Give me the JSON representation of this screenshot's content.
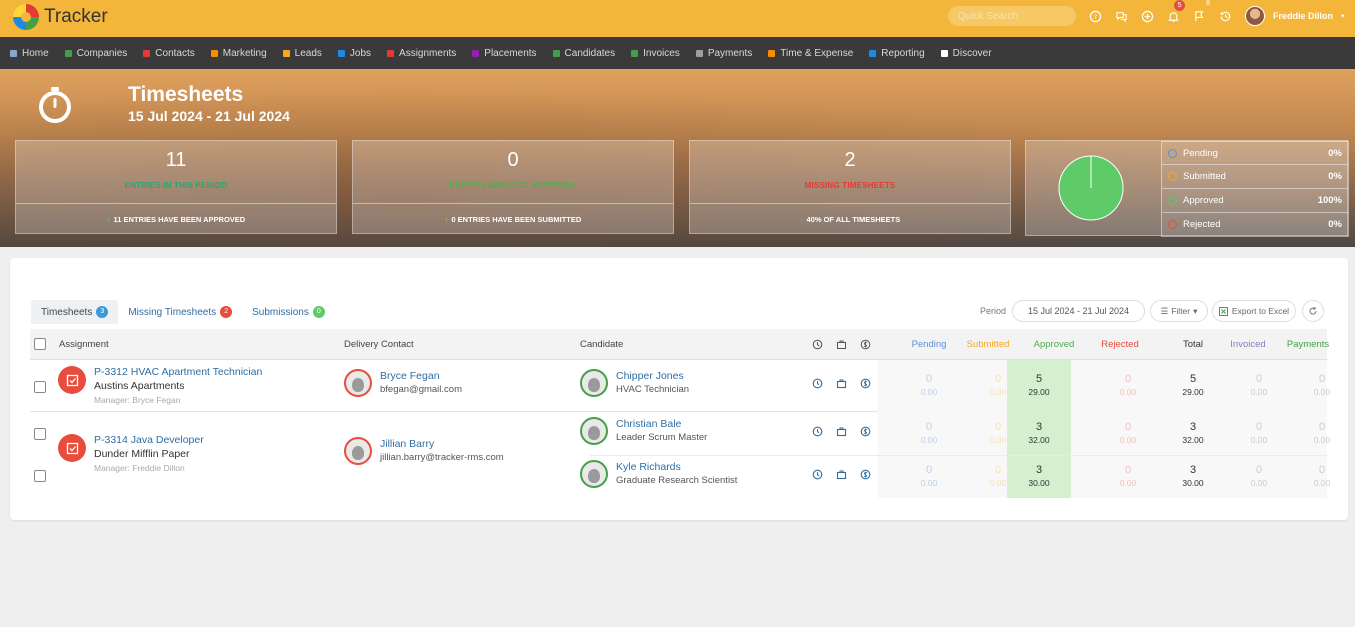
{
  "app": {
    "name": "Tracker"
  },
  "topbar": {
    "search_placeholder": "Quick Search",
    "icons": [
      "help-icon",
      "chat-icon",
      "add-icon",
      "bell-icon",
      "flag-icon",
      "history-icon"
    ],
    "bell_badge": "5",
    "flag_badge": "8",
    "user_name": "Freddie Dillon"
  },
  "nav": [
    {
      "label": "Home",
      "color": "#8aa4d6"
    },
    {
      "label": "Companies",
      "color": "#43a047"
    },
    {
      "label": "Contacts",
      "color": "#e53935"
    },
    {
      "label": "Marketing",
      "color": "#fb8c00"
    },
    {
      "label": "Leads",
      "color": "#f9a825"
    },
    {
      "label": "Jobs",
      "color": "#1e88e5"
    },
    {
      "label": "Assignments",
      "color": "#e53935"
    },
    {
      "label": "Placements",
      "color": "#8e24aa"
    },
    {
      "label": "Candidates",
      "color": "#43a047"
    },
    {
      "label": "Invoices",
      "color": "#43a047"
    },
    {
      "label": "Payments",
      "color": "#9e9e9e"
    },
    {
      "label": "Time & Expense",
      "color": "#fb8c00"
    },
    {
      "label": "Reporting",
      "color": "#1e88e5"
    },
    {
      "label": "Discover",
      "color": "#ffffff"
    }
  ],
  "hero": {
    "title": "Timesheets",
    "date_range": "15 Jul 2024 - 21 Jul 2024",
    "cards": [
      {
        "value": "11",
        "label": "ENTRIES IN THIS PERIOD",
        "label_color": "#2fa36b",
        "footer": "11 ENTRIES HAVE BEEN APPROVED",
        "arrow": "↑",
        "arrow_color": "#6fcf7a"
      },
      {
        "value": "0",
        "label": "ENTRIES AWAITING APPROVAL",
        "label_color": "#4caf50",
        "footer": "0 ENTRIES HAVE BEEN SUBMITTED",
        "arrow": "↑",
        "arrow_color": "#f0a060"
      },
      {
        "value": "2",
        "label": "MISSING TIMESHEETS",
        "label_color": "#e53935",
        "footer": "40% OF ALL TIMESHEETS",
        "arrow": "↓",
        "arrow_color": "#e57373"
      }
    ],
    "legend": [
      {
        "name": "Pending",
        "value": "0%",
        "color": "#5b8fd6"
      },
      {
        "name": "Submitted",
        "value": "0%",
        "color": "#f5a623"
      },
      {
        "name": "Approved",
        "value": "100%",
        "color": "#5ecb68"
      },
      {
        "name": "Rejected",
        "value": "0%",
        "color": "#e74c3c"
      }
    ]
  },
  "chart_data": {
    "type": "pie",
    "categories": [
      "Pending",
      "Submitted",
      "Approved",
      "Rejected"
    ],
    "values": [
      0,
      0,
      100,
      0
    ]
  },
  "tabs": [
    {
      "label": "Timesheets",
      "count": "3",
      "badge_color": "#3a9ad9"
    },
    {
      "label": "Missing Timesheets",
      "count": "2",
      "badge_color": "#e74c3c"
    },
    {
      "label": "Submissions",
      "count": "0",
      "badge_color": "#5ecb68"
    }
  ],
  "toolbar": {
    "period_label": "Period",
    "period_value": "15 Jul 2024 - 21 Jul 2024",
    "filter_label": "Filter",
    "export_label": "Export to Excel"
  },
  "table": {
    "headers": {
      "assignment": "Assignment",
      "delivery_contact": "Delivery Contact",
      "candidate": "Candidate",
      "pending": "Pending",
      "submitted": "Submitted",
      "approved": "Approved",
      "rejected": "Rejected",
      "total": "Total",
      "invoiced": "Invoiced",
      "payments": "Payments"
    },
    "groups": [
      {
        "assignment": {
          "title": "P-3312 HVAC Apartment Technician",
          "company": "Austins Apartments",
          "manager": "Manager: Bryce Fegan"
        },
        "contact": {
          "name": "Bryce Fegan",
          "email": "bfegan@gmail.com"
        },
        "rows": [
          {
            "candidate": "Chipper Jones",
            "role": "HVAC Technician",
            "pending": [
              "0",
              "0.00"
            ],
            "submitted": [
              "0",
              "0.00"
            ],
            "approved": [
              "5",
              "29.00"
            ],
            "rejected": [
              "0",
              "0.00"
            ],
            "total": [
              "5",
              "29.00"
            ],
            "invoiced": [
              "0",
              "0.00"
            ],
            "payments": [
              "0",
              "0.00"
            ]
          }
        ]
      },
      {
        "assignment": {
          "title": "P-3314 Java Developer",
          "company": "Dunder Mifflin Paper",
          "manager": "Manager: Freddie Dillon"
        },
        "contact": {
          "name": "Jillian Barry",
          "email": "jillian.barry@tracker-rms.com"
        },
        "rows": [
          {
            "candidate": "Christian Bale",
            "role": "Leader Scrum Master",
            "pending": [
              "0",
              "0.00"
            ],
            "submitted": [
              "0",
              "0.00"
            ],
            "approved": [
              "3",
              "32.00"
            ],
            "rejected": [
              "0",
              "0.00"
            ],
            "total": [
              "3",
              "32.00"
            ],
            "invoiced": [
              "0",
              "0.00"
            ],
            "payments": [
              "0",
              "0.00"
            ]
          },
          {
            "candidate": "Kyle Richards",
            "role": "Graduate Research Scientist",
            "pending": [
              "0",
              "0.00"
            ],
            "submitted": [
              "0",
              "0.00"
            ],
            "approved": [
              "3",
              "30.00"
            ],
            "rejected": [
              "0",
              "0.00"
            ],
            "total": [
              "3",
              "30.00"
            ],
            "invoiced": [
              "0",
              "0.00"
            ],
            "payments": [
              "0",
              "0.00"
            ]
          }
        ]
      }
    ]
  },
  "colors": {
    "topbar": "#f3b63a",
    "navbar": "#3a3a3a",
    "link": "#2f6ea5",
    "pending": "#5b8fd6",
    "submitted": "#f5a623",
    "approved": "#4caf50",
    "rejected": "#e74c3c",
    "invoiced": "#8e7cc3",
    "payments": "#43a047"
  }
}
